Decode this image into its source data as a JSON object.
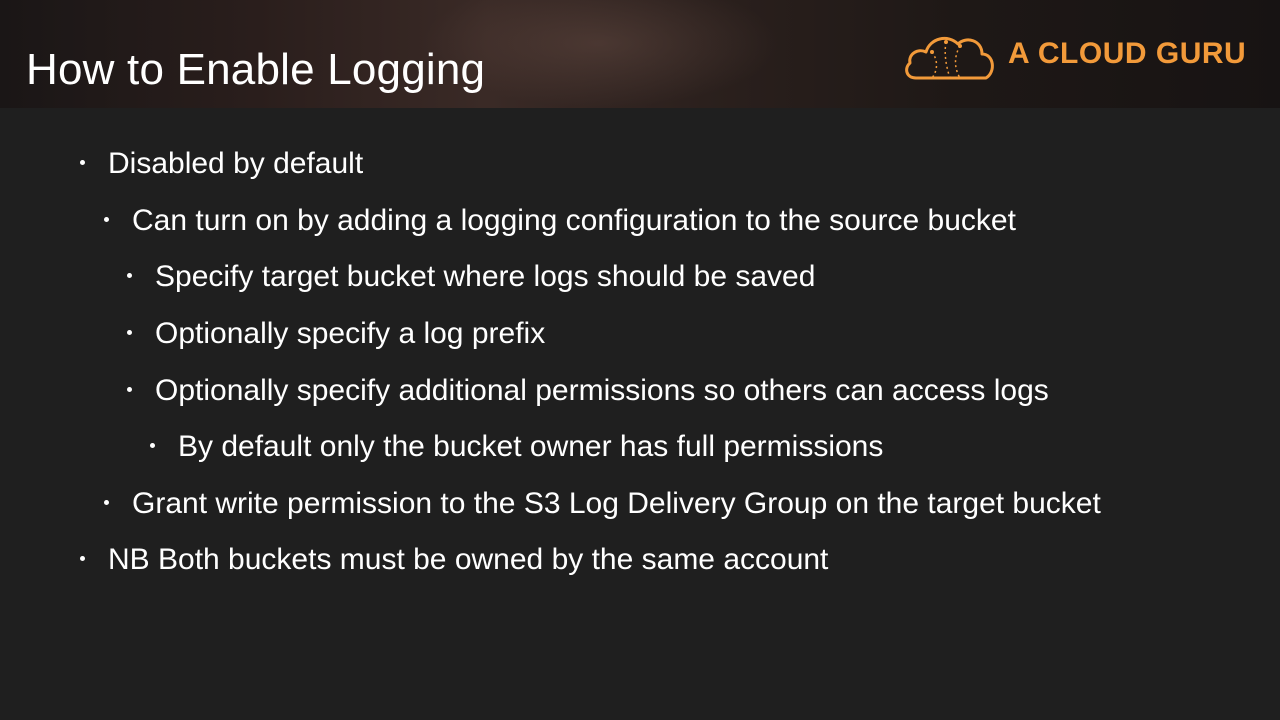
{
  "slide": {
    "title": "How to Enable Logging",
    "logo_text": "A CLOUD GURU",
    "brand_color": "#f29a3a",
    "background_color": "#1f1f1f"
  },
  "bullets": [
    {
      "level": 1,
      "text": "Disabled by default"
    },
    {
      "level": 2,
      "text": "Can turn on by adding a logging configuration to the source bucket"
    },
    {
      "level": 3,
      "text": "Specify target bucket where logs should be saved"
    },
    {
      "level": 3,
      "text": "Optionally specify a log prefix"
    },
    {
      "level": 3,
      "text": "Optionally specify additional permissions so others can access logs"
    },
    {
      "level": 4,
      "text": "By default only the bucket owner has full permissions"
    },
    {
      "level": 2,
      "text": "Grant write permission to the S3 Log Delivery Group on the target bucket"
    },
    {
      "level": 1,
      "text": "NB Both buckets must be owned by the same account"
    }
  ]
}
